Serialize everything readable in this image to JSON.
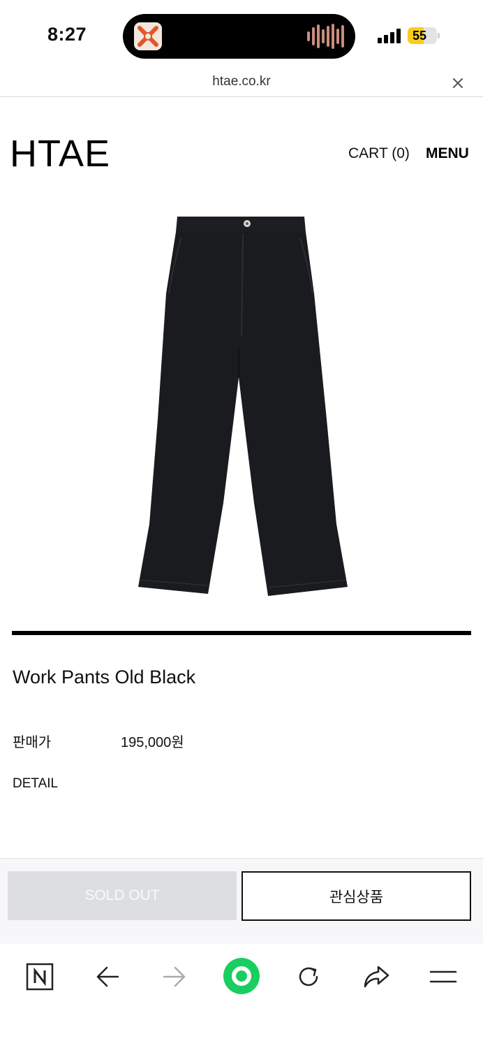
{
  "status_bar": {
    "time": "8:27",
    "battery": "55",
    "battery_level": 0.55,
    "battery_color": "#f7cd1a"
  },
  "browser": {
    "url": "htae.co.kr",
    "icons": [
      "naver-home-icon",
      "back-arrow-icon",
      "forward-arrow-icon",
      "green-circle-icon",
      "refresh-icon",
      "share-icon",
      "hamburger-menu-icon"
    ],
    "accent_color": "#19ce60"
  },
  "header": {
    "logo": "HTAE",
    "cart": "CART (0)",
    "menu": "MENU"
  },
  "product": {
    "name": "Work Pants Old Black",
    "price_label": "판매가",
    "price": "195,000원",
    "detail_label": "DETAIL",
    "image": "black-work-pants"
  },
  "actions": {
    "sold_out": "SOLD OUT",
    "wishlist": "관심상품"
  }
}
